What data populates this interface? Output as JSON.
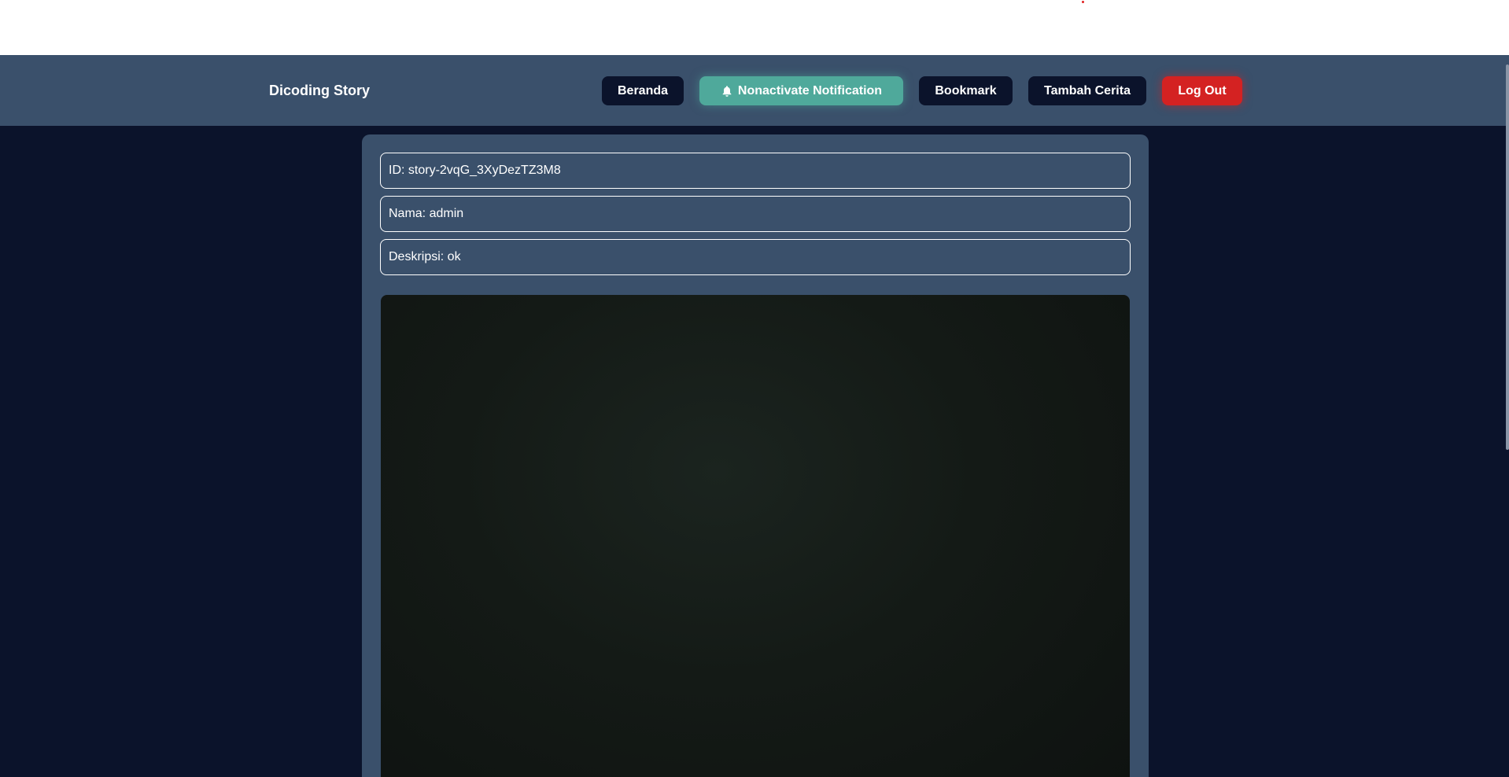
{
  "navbar": {
    "brand": "Dicoding Story",
    "buttons": {
      "beranda": "Beranda",
      "notification": "Nonactivate Notification",
      "bookmark": "Bookmark",
      "tambah_cerita": "Tambah Cerita",
      "logout": "Log Out"
    },
    "icons": {
      "notification": "bell-icon"
    }
  },
  "story": {
    "id_text": "ID: story-2vqG_3XyDezTZ3M8",
    "name_text": "Nama: admin",
    "description_text": "Deskripsi: ok"
  },
  "colors": {
    "page_bg": "#0b132b",
    "navbar_bg": "#3a506b",
    "card_bg": "#3a506b",
    "button_dark": "#0b132b",
    "notification_accent": "#4fa99b",
    "logout_accent": "#d42222"
  }
}
